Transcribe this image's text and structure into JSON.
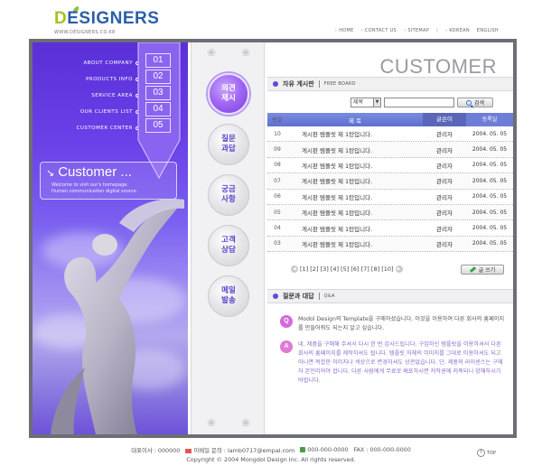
{
  "header": {
    "logo_d": "D",
    "logo_rest": "ESIGNERS",
    "logo_url": "WWW.DESIGNERS.CO.KR",
    "nav": [
      {
        "label": "HOME"
      },
      {
        "label": "CONTACT US"
      },
      {
        "label": "SITEMAP"
      }
    ],
    "lang": [
      "KOREAN",
      "ENGLISH"
    ]
  },
  "left_menu": [
    {
      "label": "ABOUT COMPANY",
      "num": "01"
    },
    {
      "label": "PRODUCTS INFO",
      "num": "02"
    },
    {
      "label": "SERVICE AREA",
      "num": "03"
    },
    {
      "label": "OUR CLIENTS LIST",
      "num": "04"
    },
    {
      "label": "CUSTOMER CENTER",
      "num": "05"
    }
  ],
  "customer_box": {
    "title": "Customer ...",
    "line1": "Welcome to visit our's homepage.",
    "line2": "Human communication digital source."
  },
  "side_buttons": [
    {
      "line1": "의견",
      "line2": "제시",
      "active": true
    },
    {
      "line1": "질문",
      "line2": "과답",
      "active": false
    },
    {
      "line1": "궁금",
      "line2": "사항",
      "active": false
    },
    {
      "line1": "고객",
      "line2": "상담",
      "active": false
    },
    {
      "line1": "메일",
      "line2": "발송",
      "active": false
    }
  ],
  "page_heading": "CUSTOMER",
  "board": {
    "title": "자유 게시판",
    "subtitle": "FREE BOARD",
    "search_select": "제목",
    "search_button": "검색",
    "columns": {
      "no": "번호",
      "title": "제     목",
      "author": "글쓴이",
      "date": "등록일"
    },
    "rows": [
      {
        "no": "10",
        "title": "게시판 템플릿 제 1탄입니다.",
        "author": "관리자",
        "date": "2004. 05. 05"
      },
      {
        "no": "09",
        "title": "게시판 템플릿 제 1탄입니다.",
        "author": "관리자",
        "date": "2004. 05. 05"
      },
      {
        "no": "08",
        "title": "게시판 템플릿 제 1탄입니다.",
        "author": "관리자",
        "date": "2004. 05. 05"
      },
      {
        "no": "07",
        "title": "게시판 템플릿 제 1탄입니다.",
        "author": "관리자",
        "date": "2004. 05. 05"
      },
      {
        "no": "06",
        "title": "게시판 템플릿 제 1탄입니다.",
        "author": "관리자",
        "date": "2004. 05. 05"
      },
      {
        "no": "05",
        "title": "게시판 템플릿 제 1탄입니다.",
        "author": "관리자",
        "date": "2004. 05. 05"
      },
      {
        "no": "04",
        "title": "게시판 템플릿 제 1탄입니다.",
        "author": "관리자",
        "date": "2004. 05. 05"
      },
      {
        "no": "03",
        "title": "게시판 템플릿 제 1탄입니다.",
        "author": "관리자",
        "date": "2004. 05. 05"
      }
    ],
    "pages": "[1] [2] [3] [4] [5] [6] [7] [8] [10]",
    "write_button": "글 쓰기"
  },
  "qa": {
    "title": "질문과 대답",
    "subtitle": "Q&A",
    "q_badge": "Q",
    "a_badge": "A",
    "question": "Modol Design의 Template을 구매하셨습니다. 이것을 이용하여 다른 회사의 홈페이지를 만들어줘도 되는지 알고 싶습니다.",
    "answer": "네. 제품을 구매해 주셔서 다시 한 번 감사드립니다. 구입하신 템플릿을 이용하셔서 다른 회사의 홈페이지를 제작하셔도 됩니다. 템플릿 자체의 이미지를 그대로 이용하셔도 되고 아니면 적합한 이미지나 색상으로 변경하셔도 상관없습니다. 단, 제품의 라이센스는 구매자 본인이어야 합니다. 다른 사람에게 무료로 배포하시면 저작권에 저촉되니 양해하시기 바랍니다."
  },
  "footer": {
    "rep": "대표이사 : 000000",
    "email": "이메일 문의 : lamb0717@empal.com",
    "phone": "000-000-0000",
    "fax": "FAX : 000-000-0000",
    "copyright": "Copyright © 2004 Mongdol Design Inc. All rights reserved.",
    "top": "TOP"
  },
  "colors": {
    "accent": "#5c4bd8",
    "frame": "#6d6e75",
    "table_head": "#5d6fcf"
  }
}
